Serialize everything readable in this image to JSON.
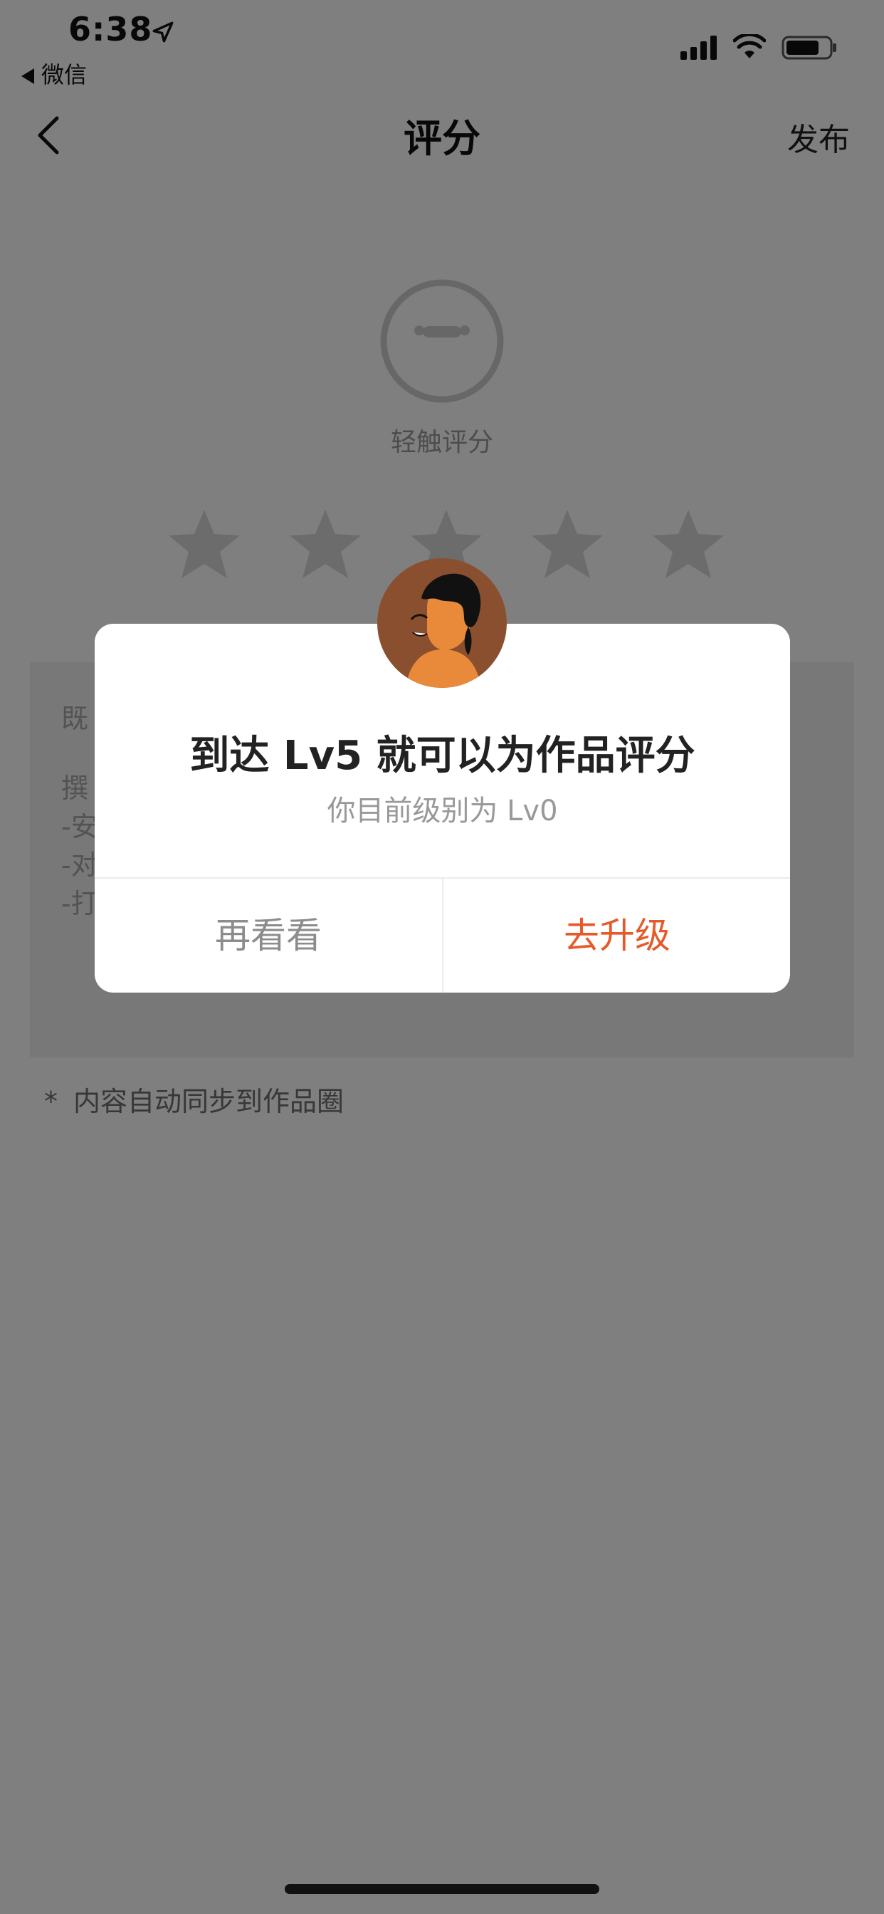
{
  "status_bar": {
    "time": "6:38",
    "back_app": "微信"
  },
  "nav": {
    "title": "评分",
    "publish": "发布"
  },
  "rating": {
    "hint": "轻触评分",
    "star_count": 5,
    "selected": 0
  },
  "textbox": {
    "lines": [
      "既",
      "撰",
      "-安",
      "-对",
      "-打"
    ]
  },
  "sync_note": {
    "mark": "*",
    "text": "内容自动同步到作品圈"
  },
  "dialog": {
    "title": "到达 Lv5 就可以为作品评分",
    "subtitle": "你目前级别为 Lv0",
    "cancel_label": "再看看",
    "upgrade_label": "去升级"
  },
  "colors": {
    "accent": "#e55a2b",
    "overlay": "rgba(0,0,0,0.5)"
  },
  "icons": [
    "location-arrow-icon",
    "back-triangle-icon",
    "signal-icon",
    "wifi-icon",
    "battery-icon",
    "chevron-left-icon",
    "neutral-face-icon",
    "star-icon",
    "avatar-illustration"
  ]
}
